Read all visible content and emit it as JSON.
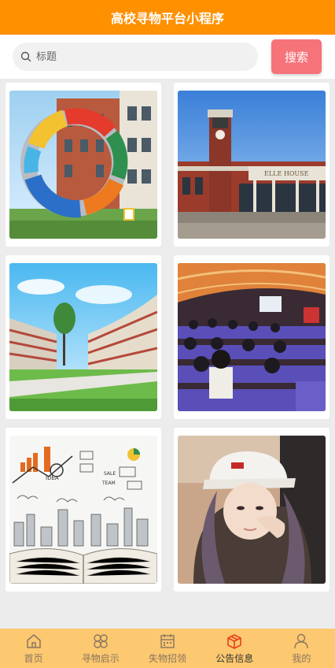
{
  "header": {
    "title": "高校寻物平台小程序"
  },
  "search": {
    "placeholder": "标题",
    "button_label": "搜索"
  },
  "cards": [
    {
      "name": "campus-sculpture-image"
    },
    {
      "name": "clock-tower-building-image"
    },
    {
      "name": "curved-building-courtyard-image"
    },
    {
      "name": "lecture-hall-audience-image"
    },
    {
      "name": "open-book-sketch-image"
    },
    {
      "name": "girl-with-cap-photo"
    }
  ],
  "tabbar": {
    "items": [
      {
        "label": "首页",
        "icon": "home-icon"
      },
      {
        "label": "寻物启示",
        "icon": "grid-icon"
      },
      {
        "label": "失物招领",
        "icon": "calendar-icon"
      },
      {
        "label": "公告信息",
        "icon": "box-icon",
        "active": true
      },
      {
        "label": "我的",
        "icon": "user-icon"
      }
    ]
  },
  "colors": {
    "header": "#ff9000",
    "search_button": "#f6737a",
    "tabbar": "#fcc870",
    "active_icon": "#e8401c"
  }
}
